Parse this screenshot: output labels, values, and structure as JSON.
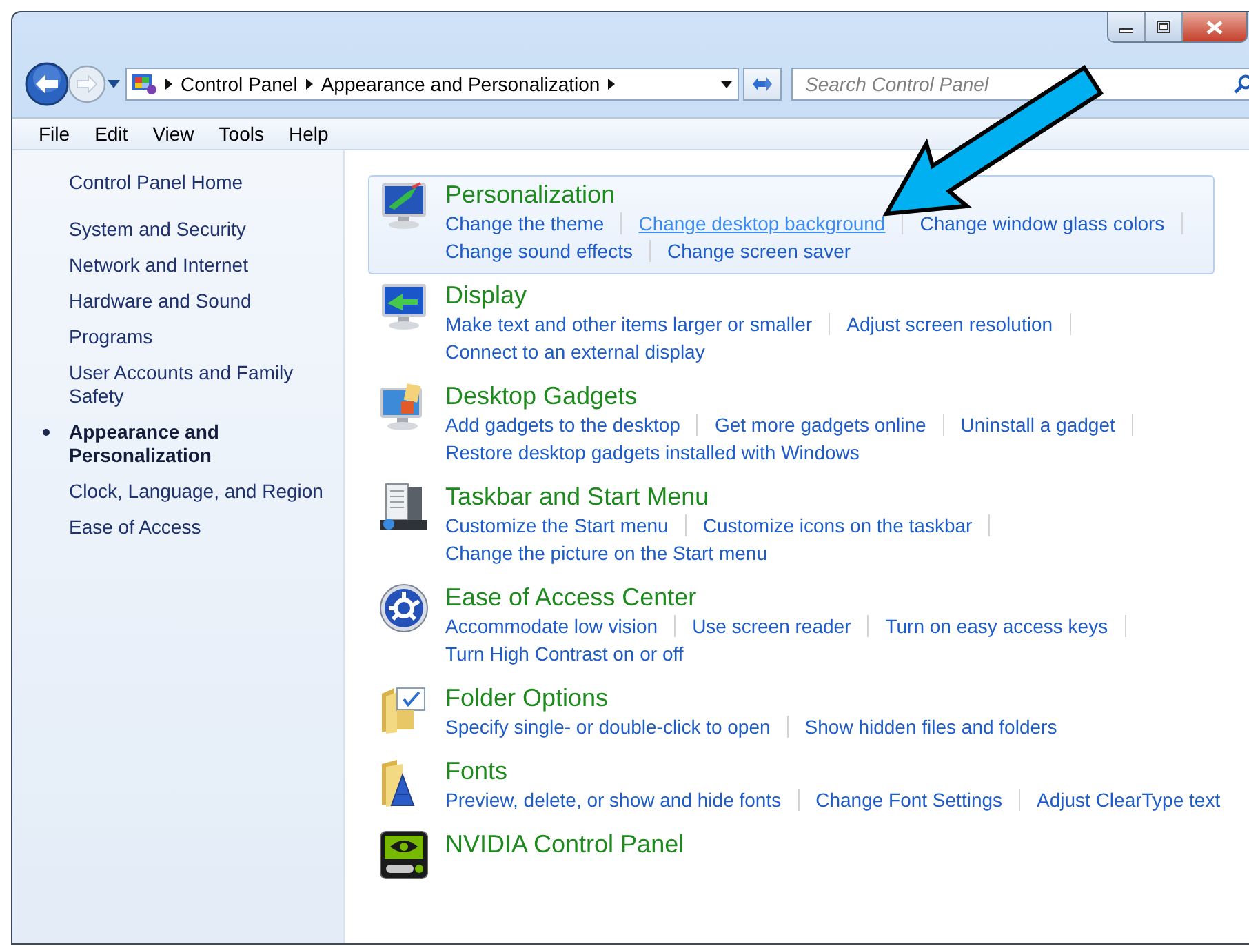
{
  "address_bar": {
    "breadcrumbs": [
      "Control Panel",
      "Appearance and Personalization"
    ]
  },
  "search": {
    "placeholder": "Search Control Panel"
  },
  "menu_bar": [
    "File",
    "Edit",
    "View",
    "Tools",
    "Help"
  ],
  "sidebar": {
    "home": "Control Panel Home",
    "items": [
      {
        "label": "System and Security",
        "selected": false
      },
      {
        "label": "Network and Internet",
        "selected": false
      },
      {
        "label": "Hardware and Sound",
        "selected": false
      },
      {
        "label": "Programs",
        "selected": false
      },
      {
        "label": "User Accounts and Family Safety",
        "selected": false
      },
      {
        "label": "Appearance and Personalization",
        "selected": true
      },
      {
        "label": "Clock, Language, and Region",
        "selected": false
      },
      {
        "label": "Ease of Access",
        "selected": false
      }
    ]
  },
  "categories": [
    {
      "title": "Personalization",
      "highlighted": true,
      "link_lines": [
        [
          {
            "text": "Change the theme",
            "hovered": false
          },
          {
            "text": "Change desktop background",
            "hovered": true
          },
          {
            "text": "Change window glass colors",
            "hovered": false
          }
        ],
        [
          {
            "text": "Change sound effects",
            "hovered": false
          },
          {
            "text": "Change screen saver",
            "hovered": false
          }
        ]
      ]
    },
    {
      "title": "Display",
      "highlighted": false,
      "link_lines": [
        [
          {
            "text": "Make text and other items larger or smaller",
            "hovered": false
          },
          {
            "text": "Adjust screen resolution",
            "hovered": false
          }
        ],
        [
          {
            "text": "Connect to an external display",
            "hovered": false
          }
        ]
      ]
    },
    {
      "title": "Desktop Gadgets",
      "highlighted": false,
      "link_lines": [
        [
          {
            "text": "Add gadgets to the desktop",
            "hovered": false
          },
          {
            "text": "Get more gadgets online",
            "hovered": false
          },
          {
            "text": "Uninstall a gadget",
            "hovered": false
          }
        ],
        [
          {
            "text": "Restore desktop gadgets installed with Windows",
            "hovered": false
          }
        ]
      ]
    },
    {
      "title": "Taskbar and Start Menu",
      "highlighted": false,
      "link_lines": [
        [
          {
            "text": "Customize the Start menu",
            "hovered": false
          },
          {
            "text": "Customize icons on the taskbar",
            "hovered": false
          }
        ],
        [
          {
            "text": "Change the picture on the Start menu",
            "hovered": false
          }
        ]
      ]
    },
    {
      "title": "Ease of Access Center",
      "highlighted": false,
      "link_lines": [
        [
          {
            "text": "Accommodate low vision",
            "hovered": false
          },
          {
            "text": "Use screen reader",
            "hovered": false
          },
          {
            "text": "Turn on easy access keys",
            "hovered": false
          }
        ],
        [
          {
            "text": "Turn High Contrast on or off",
            "hovered": false
          }
        ]
      ]
    },
    {
      "title": "Folder Options",
      "highlighted": false,
      "link_lines": [
        [
          {
            "text": "Specify single- or double-click to open",
            "hovered": false
          },
          {
            "text": "Show hidden files and folders",
            "hovered": false
          }
        ]
      ]
    },
    {
      "title": "Fonts",
      "highlighted": false,
      "link_lines": [
        [
          {
            "text": "Preview, delete, or show and hide fonts",
            "hovered": false
          },
          {
            "text": "Change Font Settings",
            "hovered": false
          },
          {
            "text": "Adjust ClearType text",
            "hovered": false
          }
        ]
      ]
    },
    {
      "title": "NVIDIA Control Panel",
      "highlighted": false
    }
  ]
}
